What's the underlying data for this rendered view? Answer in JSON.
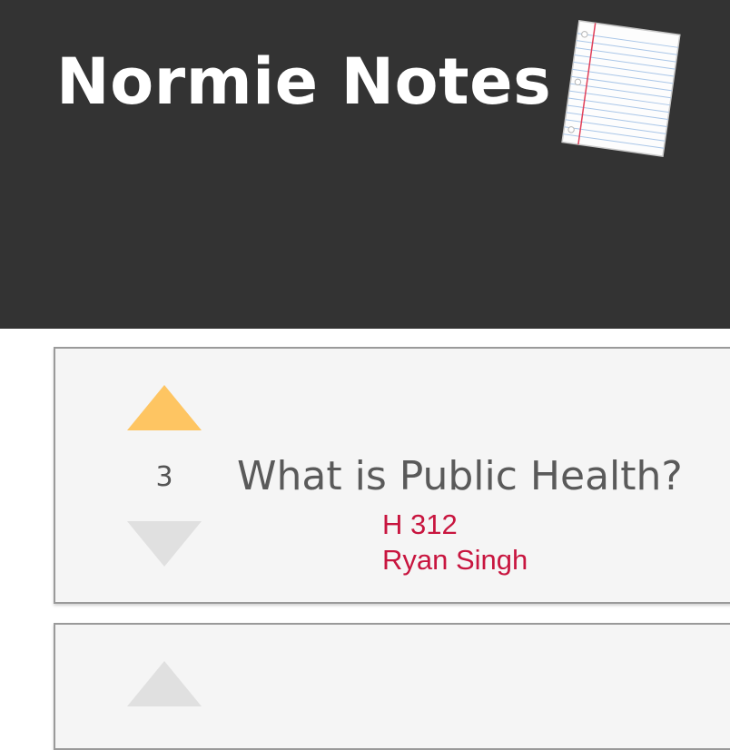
{
  "app": {
    "title": "Normie Notes",
    "logo_icon": "notebook-paper-icon"
  },
  "colors": {
    "header_bg": "#333333",
    "card_bg": "#f5f5f5",
    "upvote_active": "#fec562",
    "vote_inactive": "#e0e0e0",
    "link_red": "#c8153f"
  },
  "notes": [
    {
      "score": "3",
      "title": "What is Public Health?",
      "course": "H 312",
      "author": "Ryan Singh",
      "upvoted": true,
      "upvote_icon": "triangle-up-icon",
      "downvote_icon": "triangle-down-icon"
    },
    {
      "upvoted": false,
      "upvote_icon": "triangle-up-icon"
    }
  ]
}
